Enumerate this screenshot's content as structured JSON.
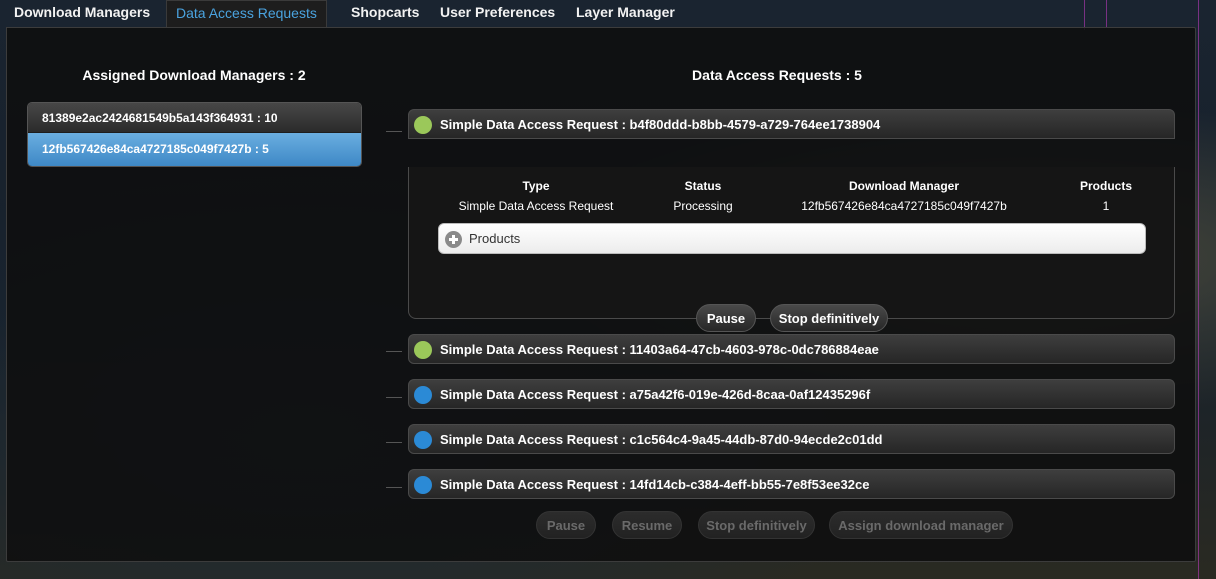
{
  "tabs": [
    {
      "label": "Download Managers",
      "active": false
    },
    {
      "label": "Data Access Requests",
      "active": true
    },
    {
      "label": "Shopcarts",
      "active": false
    },
    {
      "label": "User Preferences",
      "active": false
    },
    {
      "label": "Layer Manager",
      "active": false
    }
  ],
  "left_panel": {
    "title": "Assigned Download Managers : 2",
    "managers": [
      {
        "label": "81389e2ac2424681549b5a143f364931 : 10",
        "selected": false
      },
      {
        "label": "12fb567426e84ca4727185c049f7427b : 5",
        "selected": true
      }
    ]
  },
  "right_panel": {
    "title": "Data Access Requests : 5",
    "requests": [
      {
        "title": "Simple Data Access Request : b4f80ddd-b8bb-4579-a729-764ee1738904",
        "status_color": "#9bc85a",
        "expanded": true
      },
      {
        "title": "Simple Data Access Request : 11403a64-47cb-4603-978c-0dc786884eae",
        "status_color": "#9bc85a",
        "expanded": false
      },
      {
        "title": "Simple Data Access Request : a75a42f6-019e-426d-8caa-0af12435296f",
        "status_color": "#2b8ad6",
        "expanded": false
      },
      {
        "title": "Simple Data Access Request : c1c564c4-9a45-44db-87d0-94ecde2c01dd",
        "status_color": "#2b8ad6",
        "expanded": false
      },
      {
        "title": "Simple Data Access Request : 14fd14cb-c384-4eff-bb55-7e8f53ee32ce",
        "status_color": "#2b8ad6",
        "expanded": false
      }
    ],
    "details": {
      "headers": {
        "type": "Type",
        "status": "Status",
        "download_manager": "Download Manager",
        "products": "Products"
      },
      "values": {
        "type": "Simple Data Access Request",
        "status": "Processing",
        "download_manager": "12fb567426e84ca4727185c049f7427b",
        "products": "1"
      },
      "products_label": "Products",
      "pause_label": "Pause",
      "stop_label": "Stop definitively"
    },
    "bottom_actions": {
      "pause": "Pause",
      "resume": "Resume",
      "stop": "Stop definitively",
      "assign": "Assign download manager"
    }
  },
  "icons": {
    "expand": "plus-circle-icon",
    "status": "status-dot-icon"
  }
}
